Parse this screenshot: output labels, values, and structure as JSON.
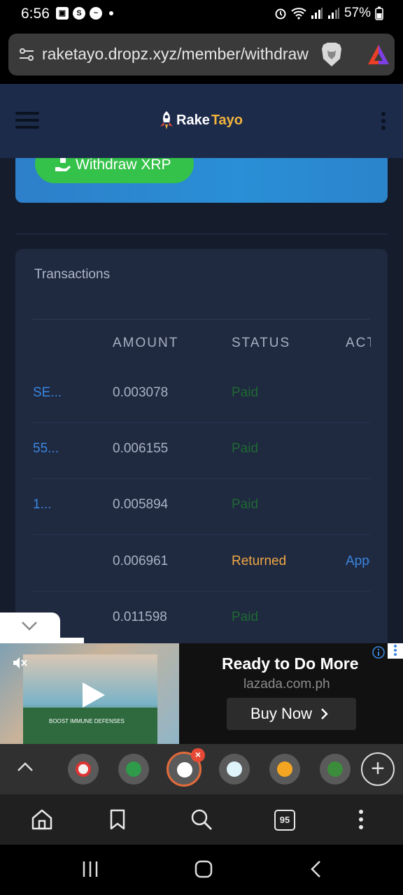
{
  "status_bar": {
    "time": "6:56",
    "battery": "57%",
    "notification_icons": [
      "gallery-icon",
      "skype-icon",
      "messenger-icon"
    ]
  },
  "browser": {
    "url": "raketayo.dropz.xyz/member/withdraw",
    "tab_count": "95"
  },
  "site": {
    "logo_part1": "Rake",
    "logo_part2": "Tayo",
    "brand_color": "#f2b43c"
  },
  "withdraw": {
    "button_label": "Withdraw XRP"
  },
  "transactions": {
    "title": "Transactions",
    "columns": [
      "AMOUNT",
      "STATUS",
      "ACTION"
    ],
    "rows": [
      {
        "id": "SE...",
        "amount": "0.003078",
        "status": "Paid",
        "action": ""
      },
      {
        "id": "55...",
        "amount": "0.006155",
        "status": "Paid",
        "action": ""
      },
      {
        "id": "1...",
        "amount": "0.005894",
        "status": "Paid",
        "action": ""
      },
      {
        "id": "",
        "amount": "0.006961",
        "status": "Returned",
        "action": "Appeal"
      },
      {
        "id": "",
        "amount": "0.011598",
        "status": "Paid",
        "action": ""
      }
    ]
  },
  "ad": {
    "title": "Ready to Do More",
    "domain": "lazada.com.ph",
    "cta": "Buy Now",
    "video_caption": "BOOST IMMUNE DEFENSES"
  }
}
